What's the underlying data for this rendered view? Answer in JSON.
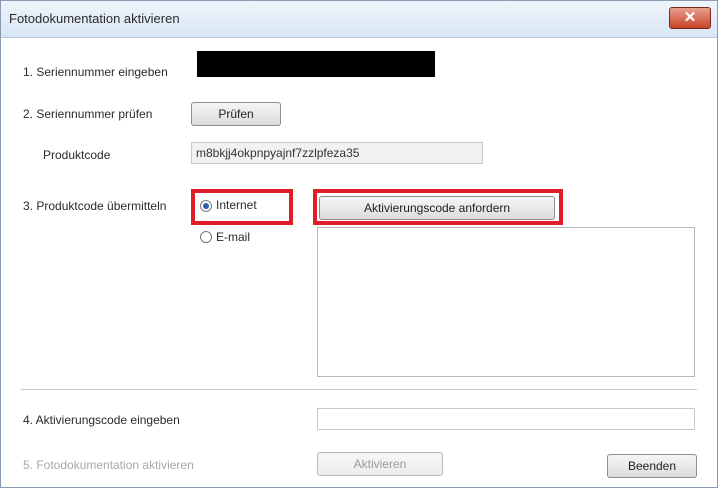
{
  "window": {
    "title": "Fotodokumentation aktivieren",
    "close_label": "✕"
  },
  "step1": {
    "label": "1. Seriennummer eingeben"
  },
  "step2": {
    "label": "2. Seriennummer prüfen",
    "button": "Prüfen"
  },
  "product": {
    "label": "Produktcode",
    "value": "m8bkjj4okpnpyajnf7zzlpfeza35"
  },
  "step3": {
    "label": "3. Produktcode übermitteln",
    "option_internet": "Internet",
    "option_email": "E-mail",
    "selected": "Internet",
    "request_button": "Aktivierungscode anfordern"
  },
  "step4": {
    "label": "4. Aktivierungscode eingeben"
  },
  "step5": {
    "label": "5. Fotodokumentation aktivieren",
    "activate_button": "Aktivieren"
  },
  "footer": {
    "exit_button": "Beenden"
  },
  "colors": {
    "highlight": "#e11d2a",
    "close_button": "#c9442a"
  }
}
